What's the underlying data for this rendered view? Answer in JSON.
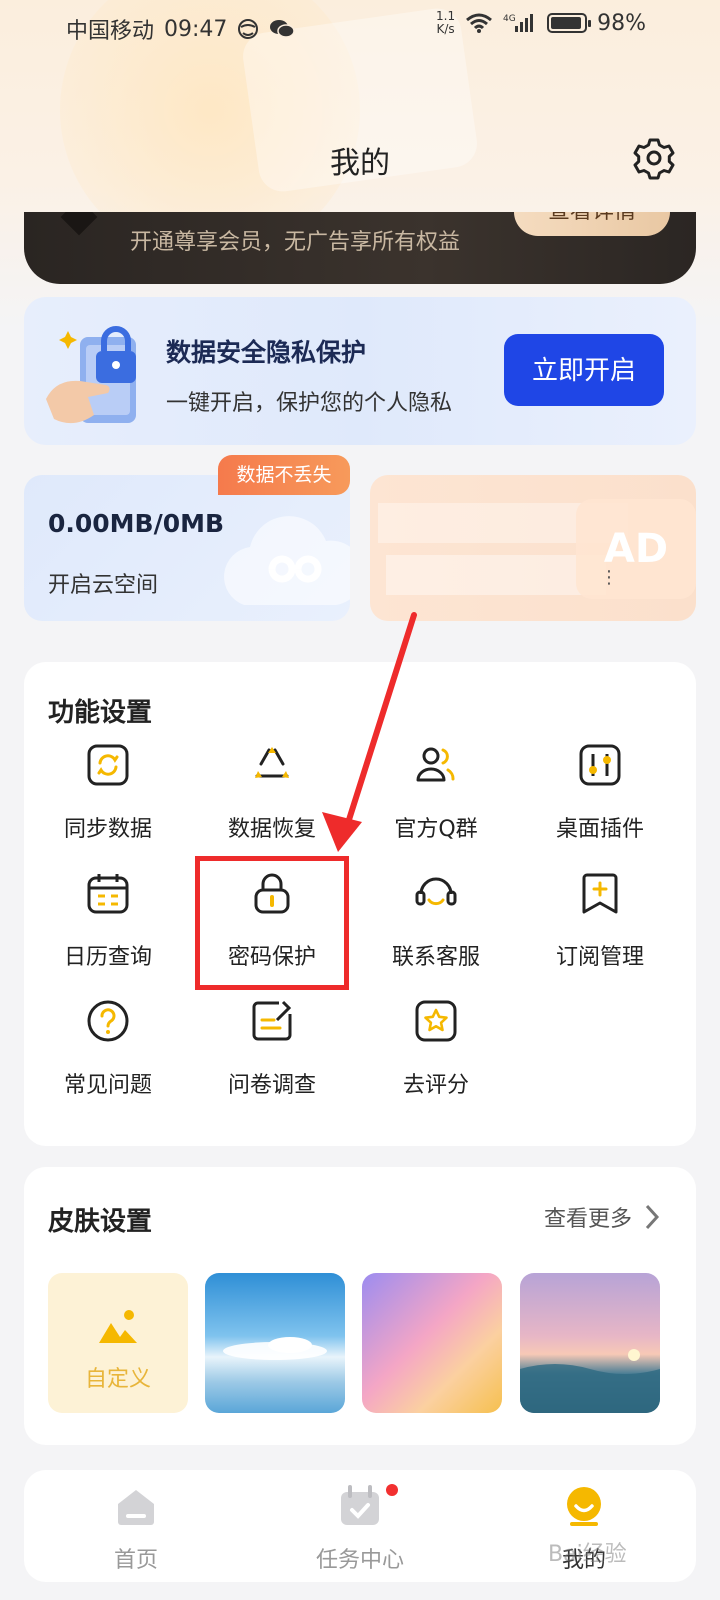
{
  "status_bar": {
    "carrier": "中国移动",
    "time": "09:47",
    "net_speed_value": "1.1",
    "net_speed_unit": "K/s",
    "battery": "98%"
  },
  "header": {
    "title": "我的"
  },
  "vip_banner": {
    "text": "开通尊享会员，无广告享所有权益",
    "button_label": "查看详情"
  },
  "privacy_card": {
    "title": "数据安全隐私保护",
    "subtitle": "一键开启，保护您的个人隐私",
    "button_label": "立即开启"
  },
  "cloud_card": {
    "badge": "数据不丢失",
    "size": "0.00MB/0MB",
    "label": "开启云空间"
  },
  "ad_card": {
    "badge": "AD"
  },
  "functions": {
    "title": "功能设置",
    "items": [
      {
        "label": "同步数据",
        "icon": "sync-icon"
      },
      {
        "label": "数据恢复",
        "icon": "recycle-icon"
      },
      {
        "label": "官方Q群",
        "icon": "group-icon"
      },
      {
        "label": "桌面插件",
        "icon": "widget-sliders-icon"
      },
      {
        "label": "日历查询",
        "icon": "calendar-icon"
      },
      {
        "label": "密码保护",
        "icon": "lock-icon"
      },
      {
        "label": "联系客服",
        "icon": "headset-icon"
      },
      {
        "label": "订阅管理",
        "icon": "bookmark-plus-icon"
      },
      {
        "label": "常见问题",
        "icon": "question-icon"
      },
      {
        "label": "问卷调查",
        "icon": "survey-edit-icon"
      },
      {
        "label": "去评分",
        "icon": "star-icon"
      }
    ]
  },
  "skins": {
    "title": "皮肤设置",
    "more_label": "查看更多",
    "custom_label": "自定义"
  },
  "bottom_nav": {
    "items": [
      {
        "label": "首页",
        "icon": "home-icon"
      },
      {
        "label": "任务中心",
        "icon": "task-calendar-icon"
      },
      {
        "label": "我的",
        "icon": "profile-smile-icon"
      }
    ],
    "active_index": 2
  },
  "watermark": "Bai经验",
  "colors": {
    "accent_yellow": "#f5b800",
    "primary_blue": "#1f46e6",
    "badge_orange": "#f57a4c",
    "annotation_red": "#ee2b2b"
  }
}
